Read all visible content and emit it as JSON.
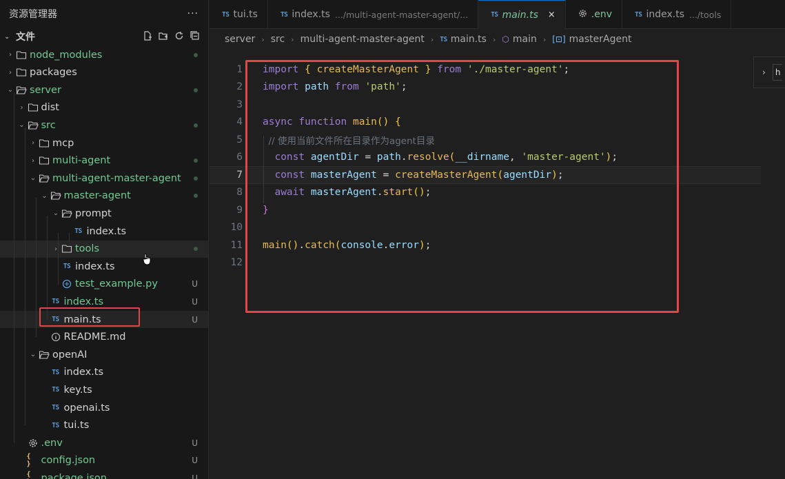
{
  "sidebar": {
    "title": "资源管理器",
    "more": "···",
    "section": "文件",
    "items": [
      {
        "label": "node_modules",
        "kind": "folder",
        "depth": 0,
        "open": false,
        "status": "dot",
        "color": "mod"
      },
      {
        "label": "packages",
        "kind": "folder",
        "depth": 0,
        "open": false,
        "status": "",
        "color": "def"
      },
      {
        "label": "server",
        "kind": "folder",
        "depth": 0,
        "open": true,
        "status": "dot",
        "color": "mod"
      },
      {
        "label": "dist",
        "kind": "folder",
        "depth": 1,
        "open": false,
        "status": "",
        "color": "def"
      },
      {
        "label": "src",
        "kind": "folder",
        "depth": 1,
        "open": true,
        "status": "dot",
        "color": "mod"
      },
      {
        "label": "mcp",
        "kind": "folder",
        "depth": 2,
        "open": false,
        "status": "",
        "color": "def"
      },
      {
        "label": "multi-agent",
        "kind": "folder",
        "depth": 2,
        "open": false,
        "status": "dot",
        "color": "mod"
      },
      {
        "label": "multi-agent-master-agent",
        "kind": "folder",
        "depth": 2,
        "open": true,
        "status": "dot",
        "color": "mod"
      },
      {
        "label": "master-agent",
        "kind": "folder",
        "depth": 3,
        "open": true,
        "status": "dot",
        "color": "mod"
      },
      {
        "label": "prompt",
        "kind": "folder",
        "depth": 4,
        "open": true,
        "status": "",
        "color": "def"
      },
      {
        "label": "index.ts",
        "kind": "ts",
        "depth": 5,
        "status": "",
        "color": "def"
      },
      {
        "label": "tools",
        "kind": "folder",
        "depth": 4,
        "open": false,
        "status": "dot",
        "color": "mod"
      },
      {
        "label": "index.ts",
        "kind": "ts",
        "depth": 4,
        "status": "",
        "color": "def"
      },
      {
        "label": "test_example.py",
        "kind": "py",
        "depth": 4,
        "status": "U",
        "color": "mod"
      },
      {
        "label": "index.ts",
        "kind": "ts",
        "depth": 3,
        "status": "U",
        "color": "mod"
      },
      {
        "label": "main.ts",
        "kind": "ts",
        "depth": 3,
        "status": "U",
        "color": "def"
      },
      {
        "label": "README.md",
        "kind": "info",
        "depth": 3,
        "status": "",
        "color": "def"
      },
      {
        "label": "openAI",
        "kind": "folder",
        "depth": 2,
        "open": true,
        "status": "",
        "color": "def"
      },
      {
        "label": "index.ts",
        "kind": "ts",
        "depth": 3,
        "status": "",
        "color": "def"
      },
      {
        "label": "key.ts",
        "kind": "ts",
        "depth": 3,
        "status": "",
        "color": "def"
      },
      {
        "label": "openai.ts",
        "kind": "ts",
        "depth": 3,
        "status": "",
        "color": "def"
      },
      {
        "label": "tui.ts",
        "kind": "ts",
        "depth": 3,
        "status": "",
        "color": "def"
      },
      {
        "label": ".env",
        "kind": "gear",
        "depth": 1,
        "status": "U",
        "color": "mod"
      },
      {
        "label": "config.json",
        "kind": "json",
        "depth": 1,
        "status": "U",
        "color": "mod"
      },
      {
        "label": "package.json",
        "kind": "json",
        "depth": 1,
        "status": "U",
        "color": "mod"
      }
    ]
  },
  "tabs": [
    {
      "icon": "TS",
      "label": "tui.ts",
      "path": ""
    },
    {
      "icon": "TS",
      "label": "index.ts",
      "path": ".../multi-agent-master-agent/..."
    },
    {
      "icon": "TS",
      "label": "main.ts",
      "path": "",
      "active": true,
      "close": "×"
    },
    {
      "icon": "gear",
      "label": ".env",
      "path": ""
    },
    {
      "icon": "TS",
      "label": "index.ts",
      "path": ".../tools"
    }
  ],
  "breadcrumb": [
    "server",
    "src",
    "multi-agent-master-agent",
    "main.ts",
    "main",
    "masterAgent"
  ],
  "editor": {
    "current_line": 7,
    "lines": [
      "import { createMasterAgent } from './master-agent';",
      "import path from 'path';",
      "",
      "async function main() {",
      "  // 使用当前文件所在目录作为agent目录",
      "  const agentDir = path.resolve(__dirname, 'master-agent');",
      "  const masterAgent = createMasterAgent(agentDir);",
      "  await masterAgent.start();",
      "}",
      "",
      "main().catch(console.error);",
      ""
    ],
    "line_numbers": [
      "1",
      "2",
      "3",
      "4",
      "5",
      "6",
      "7",
      "8",
      "9",
      "10",
      "11",
      "12"
    ]
  },
  "widget": {
    "label": "h"
  },
  "colors": {
    "highlight_box": "#e8434a",
    "ts_icon": "#5c9ad6",
    "git_modified": "#73c991"
  }
}
